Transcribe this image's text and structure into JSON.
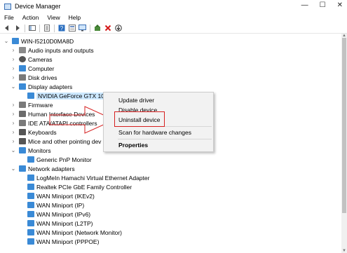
{
  "window": {
    "title": "Device Manager",
    "controls": [
      "—",
      "☐",
      "✕"
    ]
  },
  "menubar": [
    "File",
    "Action",
    "View",
    "Help"
  ],
  "toolbar": [
    "back-icon",
    "forward-icon",
    "sep",
    "show-hide-tree-icon",
    "sep",
    "properties-icon",
    "sep",
    "help-icon",
    "properties-sheet-icon",
    "monitor-scan-icon",
    "sep",
    "update-driver-icon",
    "uninstall-icon",
    "download-icon"
  ],
  "tree": {
    "root": "WIN-I5210D0MA8D",
    "items": [
      {
        "label": "Audio inputs and outputs",
        "icon": "audio-icon",
        "color": "#6b6b6b"
      },
      {
        "label": "Cameras",
        "icon": "camera-icon",
        "color": "#555555"
      },
      {
        "label": "Computer",
        "icon": "computer-icon",
        "color": "#3a8ad6"
      },
      {
        "label": "Disk drives",
        "icon": "disk-icon",
        "color": "#7a7a7a"
      },
      {
        "label": "Display adapters",
        "icon": "display-adapter-icon",
        "color": "#3a8ad6",
        "expanded": true
      },
      {
        "label": "NVIDIA GeForce GTX 1050",
        "icon": "gpu-icon",
        "color": "#3a8ad6",
        "child": true,
        "selected": true
      },
      {
        "label": "Firmware",
        "icon": "firmware-icon",
        "color": "#7a7a7a"
      },
      {
        "label": "Human Interface Devices",
        "icon": "hid-icon",
        "color": "#6b6b6b"
      },
      {
        "label": "IDE ATA/ATAPI controllers",
        "icon": "ide-icon",
        "color": "#7a7a7a"
      },
      {
        "label": "Keyboards",
        "icon": "keyboard-icon",
        "color": "#555555"
      },
      {
        "label": "Mice and other pointing dev",
        "icon": "mouse-icon",
        "color": "#555555"
      },
      {
        "label": "Monitors",
        "icon": "monitor-icon",
        "color": "#3a8ad6",
        "expanded": true
      },
      {
        "label": "Generic PnP Monitor",
        "icon": "monitor-icon",
        "color": "#3a8ad6",
        "child": true
      },
      {
        "label": "Network adapters",
        "icon": "network-icon",
        "color": "#3a8ad6",
        "expanded": true
      },
      {
        "label": "LogMeIn Hamachi Virtual Ethernet Adapter",
        "icon": "network-adapter-icon",
        "color": "#3a8ad6",
        "child": true
      },
      {
        "label": "Realtek PCIe GbE Family Controller",
        "icon": "network-adapter-icon",
        "color": "#3a8ad6",
        "child": true
      },
      {
        "label": "WAN Miniport (IKEv2)",
        "icon": "network-adapter-icon",
        "color": "#3a8ad6",
        "child": true
      },
      {
        "label": "WAN Miniport (IP)",
        "icon": "network-adapter-icon",
        "color": "#3a8ad6",
        "child": true
      },
      {
        "label": "WAN Miniport (IPv6)",
        "icon": "network-adapter-icon",
        "color": "#3a8ad6",
        "child": true
      },
      {
        "label": "WAN Miniport (L2TP)",
        "icon": "network-adapter-icon",
        "color": "#3a8ad6",
        "child": true
      },
      {
        "label": "WAN Miniport (Network Monitor)",
        "icon": "network-adapter-icon",
        "color": "#3a8ad6",
        "child": true
      },
      {
        "label": "WAN Miniport (PPPOE)",
        "icon": "network-adapter-icon",
        "color": "#3a8ad6",
        "child": true
      }
    ]
  },
  "context_menu": {
    "update_driver": "Update driver",
    "disable_device": "Disable device",
    "uninstall_device": "Uninstall device",
    "scan_for_changes": "Scan for hardware changes",
    "properties": "Properties"
  },
  "annotation_color": "#d62020"
}
